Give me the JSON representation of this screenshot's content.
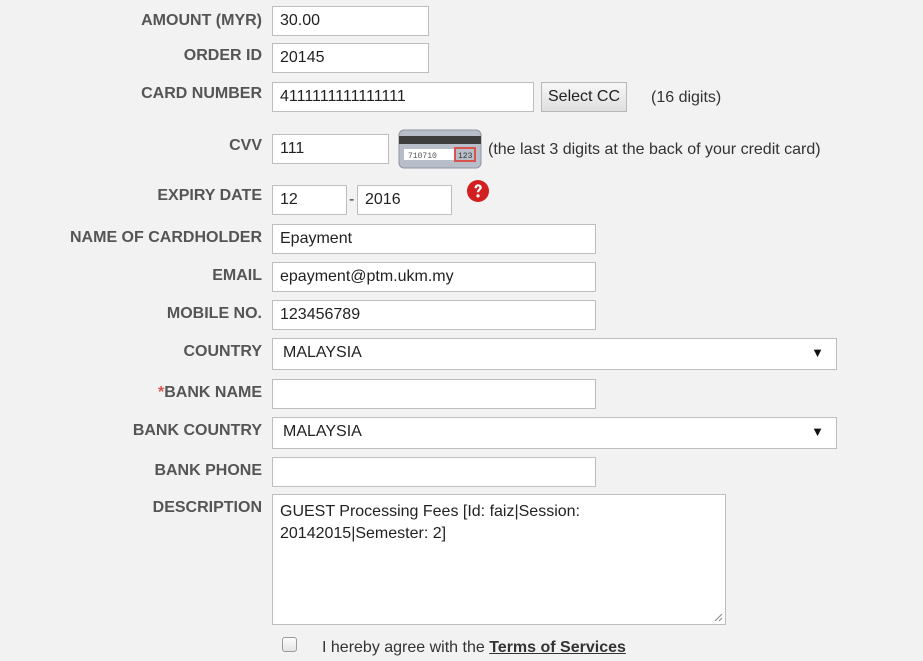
{
  "labels": {
    "amount": "AMOUNT (MYR)",
    "order_id": "ORDER ID",
    "card_number": "CARD NUMBER",
    "cvv": "CVV",
    "expiry_date": "EXPIRY DATE",
    "cardholder": "NAME OF CARDHOLDER",
    "email": "EMAIL",
    "mobile": "MOBILE NO.",
    "country": "COUNTRY",
    "bank_name_marker": "*",
    "bank_name": "BANK NAME",
    "bank_country": "BANK COUNTRY",
    "bank_phone": "BANK PHONE",
    "description": "DESCRIPTION"
  },
  "values": {
    "amount": "30.00",
    "order_id": "20145",
    "card_number": "4111111111111111",
    "cvv": "111",
    "expiry_month": "12",
    "expiry_year": "2016",
    "cardholder": "Epayment",
    "email": "epayment@ptm.ukm.my",
    "mobile": "123456789",
    "country": "MALAYSIA",
    "bank_name": "",
    "bank_country": "MALAYSIA",
    "bank_phone": "",
    "description": "GUEST Processing Fees [Id: faiz|Session: 20142015|Semester: 2]"
  },
  "buttons": {
    "select_cc": "Select CC"
  },
  "notes": {
    "card_digits": "(16 digits)",
    "cvv_hint": "(the last 3 digits at the back of your credit card)",
    "expiry_separator": "-",
    "cvv_card_digits": "710710",
    "cvv_card_code": "123"
  },
  "terms": {
    "text": "I hereby agree with the ",
    "link": "Terms of Services"
  },
  "icons": {
    "help": "question-circle-icon",
    "card": "credit-card-back-icon",
    "dropdown": "triangle-down-icon"
  },
  "colors": {
    "required_marker": "#d9534f",
    "help_icon": "#d21f1f"
  }
}
